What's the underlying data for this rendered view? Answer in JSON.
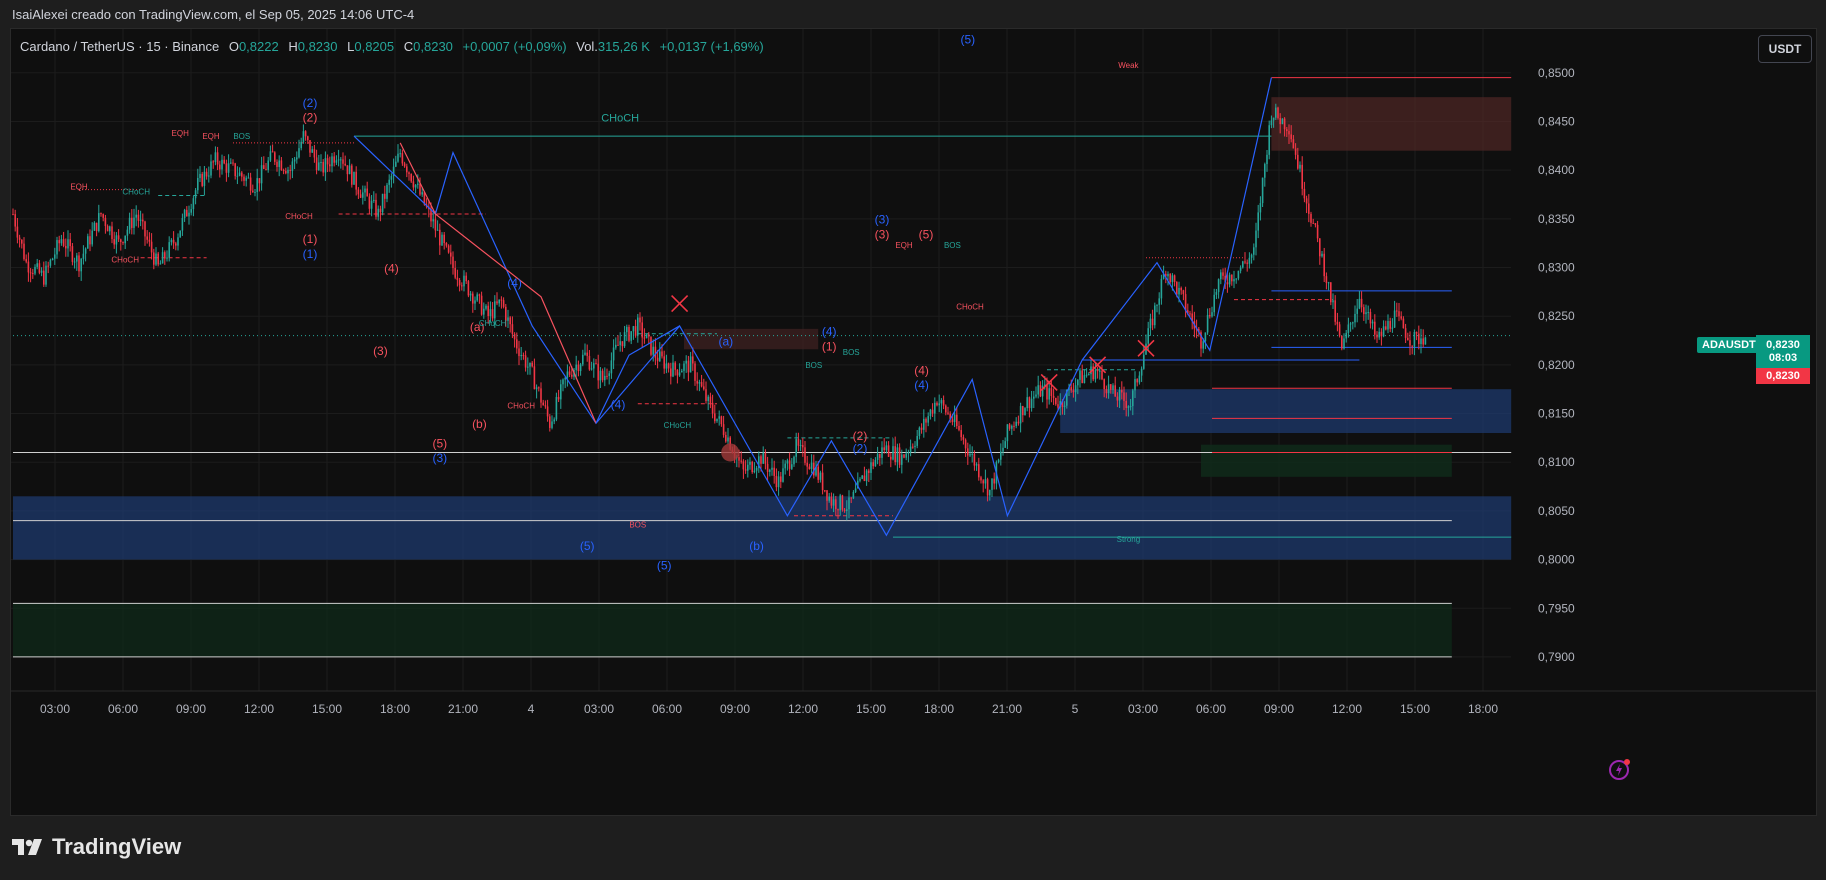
{
  "caption": "IsaiAlexei creado con TradingView.com, el Sep 05, 2025 14:06 UTC-4",
  "legend": {
    "symbol": "Cardano / TetherUS · 15 · Binance",
    "o_label": "O",
    "o": "0,8222",
    "h_label": "H",
    "h": "0,8230",
    "l_label": "L",
    "l": "0,8205",
    "c_label": "C",
    "c": "0,8230",
    "change": "+0,0007 (+0,09%)",
    "vol_label": "Vol.",
    "vol": "315,26 K",
    "vol_change": "+0,0137 (+1,69%)"
  },
  "currency_button": "USDT",
  "symbol_tag": "ADAUSDT",
  "price_tag": {
    "price": "0,8230",
    "countdown": "08:03",
    "last": "0,8230"
  },
  "brand": "TradingView",
  "colors": {
    "up": "#26a69a",
    "down": "#f23645",
    "wave_blue": "#2962ff",
    "wave_red": "#f7525f",
    "structure": "#26a69a",
    "zone_blue": "#1e3a6e"
  },
  "chart_data": {
    "type": "candlestick",
    "y_axis": {
      "ticks": [
        0.85,
        0.845,
        0.84,
        0.835,
        0.83,
        0.825,
        0.82,
        0.815,
        0.81,
        0.805,
        0.8,
        0.795,
        0.79
      ],
      "tick_labels": [
        "0,8500",
        "0,8450",
        "0,8400",
        "0,8350",
        "0,8300",
        "0,8250",
        "0,8200",
        "0,8150",
        "0,8100",
        "0,8050",
        "0,8000",
        "0,7950",
        "0,7900"
      ],
      "range": [
        0.7865,
        0.8545
      ]
    },
    "x_axis": {
      "tick_labels": [
        "03:00",
        "06:00",
        "09:00",
        "12:00",
        "15:00",
        "18:00",
        "21:00",
        "4",
        "03:00",
        "06:00",
        "09:00",
        "12:00",
        "15:00",
        "18:00",
        "21:00",
        "5",
        "03:00",
        "06:00",
        "09:00",
        "12:00",
        "15:00",
        "18:00"
      ],
      "bar_interval_minutes": 15,
      "bars_per_tick": 12
    },
    "current_price": 0.823,
    "price_path": [
      [
        0,
        0.8355
      ],
      [
        6,
        0.8305
      ],
      [
        14,
        0.829
      ],
      [
        22,
        0.833
      ],
      [
        30,
        0.8305
      ],
      [
        40,
        0.8355
      ],
      [
        48,
        0.8325
      ],
      [
        56,
        0.8355
      ],
      [
        66,
        0.83
      ],
      [
        74,
        0.833
      ],
      [
        84,
        0.8385
      ],
      [
        92,
        0.841
      ],
      [
        100,
        0.84
      ],
      [
        110,
        0.8385
      ],
      [
        118,
        0.8415
      ],
      [
        126,
        0.84
      ],
      [
        132,
        0.8435
      ],
      [
        140,
        0.84
      ],
      [
        148,
        0.842
      ],
      [
        156,
        0.8385
      ],
      [
        166,
        0.8355
      ],
      [
        176,
        0.8418
      ],
      [
        184,
        0.838
      ],
      [
        192,
        0.834
      ],
      [
        200,
        0.83
      ],
      [
        208,
        0.8275
      ],
      [
        216,
        0.825
      ],
      [
        222,
        0.8265
      ],
      [
        228,
        0.8225
      ],
      [
        236,
        0.819
      ],
      [
        244,
        0.814
      ],
      [
        252,
        0.819
      ],
      [
        260,
        0.821
      ],
      [
        268,
        0.8185
      ],
      [
        276,
        0.8225
      ],
      [
        284,
        0.824
      ],
      [
        292,
        0.821
      ],
      [
        300,
        0.8195
      ],
      [
        308,
        0.82
      ],
      [
        316,
        0.816
      ],
      [
        324,
        0.813
      ],
      [
        332,
        0.809
      ],
      [
        340,
        0.8105
      ],
      [
        348,
        0.808
      ],
      [
        356,
        0.8115
      ],
      [
        364,
        0.8095
      ],
      [
        372,
        0.806
      ],
      [
        380,
        0.8055
      ],
      [
        388,
        0.809
      ],
      [
        396,
        0.8115
      ],
      [
        404,
        0.8105
      ],
      [
        412,
        0.813
      ],
      [
        420,
        0.8165
      ],
      [
        428,
        0.814
      ],
      [
        436,
        0.8105
      ],
      [
        444,
        0.807
      ],
      [
        452,
        0.813
      ],
      [
        460,
        0.816
      ],
      [
        468,
        0.8175
      ],
      [
        476,
        0.816
      ],
      [
        484,
        0.8185
      ],
      [
        492,
        0.8195
      ],
      [
        500,
        0.817
      ],
      [
        508,
        0.816
      ],
      [
        516,
        0.823
      ],
      [
        524,
        0.83
      ],
      [
        532,
        0.8265
      ],
      [
        540,
        0.8225
      ],
      [
        548,
        0.8285
      ],
      [
        556,
        0.8295
      ],
      [
        564,
        0.8315
      ],
      [
        572,
        0.846
      ],
      [
        580,
        0.8445
      ],
      [
        588,
        0.837
      ],
      [
        596,
        0.83
      ],
      [
        604,
        0.8215
      ],
      [
        612,
        0.827
      ],
      [
        620,
        0.8225
      ],
      [
        628,
        0.825
      ],
      [
        636,
        0.8225
      ],
      [
        642,
        0.823
      ]
    ],
    "wave_labels": [
      {
        "text": "(2)",
        "color": "blue",
        "bar": 135,
        "price": 0.8465
      },
      {
        "text": "(2)",
        "color": "red",
        "bar": 135,
        "price": 0.845
      },
      {
        "text": "(1)",
        "color": "red",
        "bar": 135,
        "price": 0.8325
      },
      {
        "text": "(1)",
        "color": "blue",
        "bar": 135,
        "price": 0.831
      },
      {
        "text": "(4)",
        "color": "red",
        "bar": 172,
        "price": 0.8295
      },
      {
        "text": "(3)",
        "color": "red",
        "bar": 167,
        "price": 0.821
      },
      {
        "text": "(5)",
        "color": "red",
        "bar": 194,
        "price": 0.8115
      },
      {
        "text": "(3)",
        "color": "blue",
        "bar": 194,
        "price": 0.81
      },
      {
        "text": "(a)",
        "color": "red",
        "bar": 211,
        "price": 0.8235
      },
      {
        "text": "(b)",
        "color": "red",
        "bar": 212,
        "price": 0.8135
      },
      {
        "text": "(4)",
        "color": "blue",
        "bar": 228,
        "price": 0.828
      },
      {
        "text": "(4)",
        "color": "blue",
        "bar": 275,
        "price": 0.8155
      },
      {
        "text": "(5)",
        "color": "blue",
        "bar": 261,
        "price": 0.801
      },
      {
        "text": "(5)",
        "color": "blue",
        "bar": 296,
        "price": 0.799
      },
      {
        "text": "(a)",
        "color": "blue",
        "bar": 324,
        "price": 0.822
      },
      {
        "text": "(b)",
        "color": "blue",
        "bar": 338,
        "price": 0.801
      },
      {
        "text": "(4)",
        "color": "blue",
        "bar": 371,
        "price": 0.823
      },
      {
        "text": "(1)",
        "color": "red",
        "bar": 371,
        "price": 0.8215
      },
      {
        "text": "(3)",
        "color": "blue",
        "bar": 395,
        "price": 0.8345
      },
      {
        "text": "(3)",
        "color": "red",
        "bar": 395,
        "price": 0.833
      },
      {
        "text": "(5)",
        "color": "red",
        "bar": 415,
        "price": 0.833
      },
      {
        "text": "(4)",
        "color": "red",
        "bar": 413,
        "price": 0.819
      },
      {
        "text": "(4)",
        "color": "blue",
        "bar": 413,
        "price": 0.8175
      },
      {
        "text": "(2)",
        "color": "red",
        "bar": 385,
        "price": 0.8123
      },
      {
        "text": "(2)",
        "color": "blue",
        "bar": 385,
        "price": 0.811
      },
      {
        "text": "(5)",
        "color": "blue",
        "bar": 434,
        "price": 0.853
      }
    ],
    "structure_labels": [
      {
        "text": "CHoCH",
        "color": "teal",
        "bar": 276,
        "price": 0.845
      },
      {
        "text": "EQH",
        "color": "red",
        "bar": 76,
        "price": 0.8435
      },
      {
        "text": "EQH",
        "color": "red",
        "bar": 90,
        "price": 0.8432
      },
      {
        "text": "BOS",
        "color": "teal",
        "bar": 104,
        "price": 0.8432
      },
      {
        "text": "EQH",
        "color": "red",
        "bar": 30,
        "price": 0.838
      },
      {
        "text": "CHoCH",
        "color": "teal",
        "bar": 56,
        "price": 0.8375
      },
      {
        "text": "CHoCH",
        "color": "red",
        "bar": 51,
        "price": 0.8305
      },
      {
        "text": "CHoCH",
        "color": "red",
        "bar": 130,
        "price": 0.835
      },
      {
        "text": "CHoCH",
        "color": "teal",
        "bar": 218,
        "price": 0.824
      },
      {
        "text": "CHoCH",
        "color": "red",
        "bar": 231,
        "price": 0.8155
      },
      {
        "text": "CHoCH",
        "color": "teal",
        "bar": 302,
        "price": 0.8135
      },
      {
        "text": "BOS",
        "color": "red",
        "bar": 284,
        "price": 0.8033
      },
      {
        "text": "BOS",
        "color": "teal",
        "bar": 364,
        "price": 0.8197
      },
      {
        "text": "BOS",
        "color": "teal",
        "bar": 381,
        "price": 0.821
      },
      {
        "text": "EQH",
        "color": "red",
        "bar": 405,
        "price": 0.832
      },
      {
        "text": "BOS",
        "color": "teal",
        "bar": 427,
        "price": 0.832
      },
      {
        "text": "CHoCH",
        "color": "red",
        "bar": 435,
        "price": 0.8257
      },
      {
        "text": "Weak",
        "color": "red",
        "bar": 507,
        "price": 0.8505
      },
      {
        "text": "Strong",
        "color": "teal",
        "bar": 507,
        "price": 0.8018
      }
    ]
  }
}
